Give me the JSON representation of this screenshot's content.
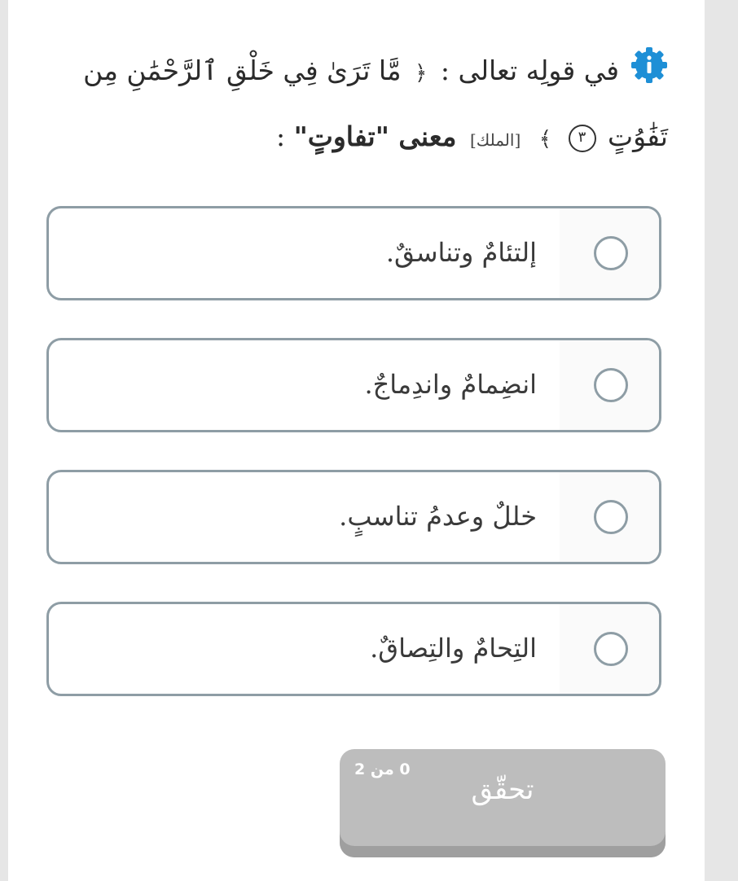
{
  "question": {
    "prefix": "في قولِه تعالى : ",
    "verse_line1": "مَّا تَرَىٰ فِي خَلْقِ ٱلرَّحْمَٰنِ مِن",
    "verse_line2": "تَفَٰوُتٍ",
    "ayah_number": "٣",
    "sura": "[الملك]",
    "meaning": "معنى \"تفاوتٍ\"",
    "suffix": " :"
  },
  "options": [
    {
      "label": "إلتئامٌ وتناسقٌ."
    },
    {
      "label": "انضِمامٌ واندِماجٌ."
    },
    {
      "label": "خللٌ وعدمُ تناسبٍ."
    },
    {
      "label": "التِحامٌ والتِصاقٌ."
    }
  ],
  "check_button": {
    "label": "تحقّق",
    "count": "0 من 2"
  },
  "colors": {
    "info_icon": "#1e8fd6",
    "border": "#8e9da5",
    "button": "#bdbdbd"
  },
  "icons": {
    "info": "info-gear-badge-icon",
    "radio": "radio-circle-icon"
  }
}
